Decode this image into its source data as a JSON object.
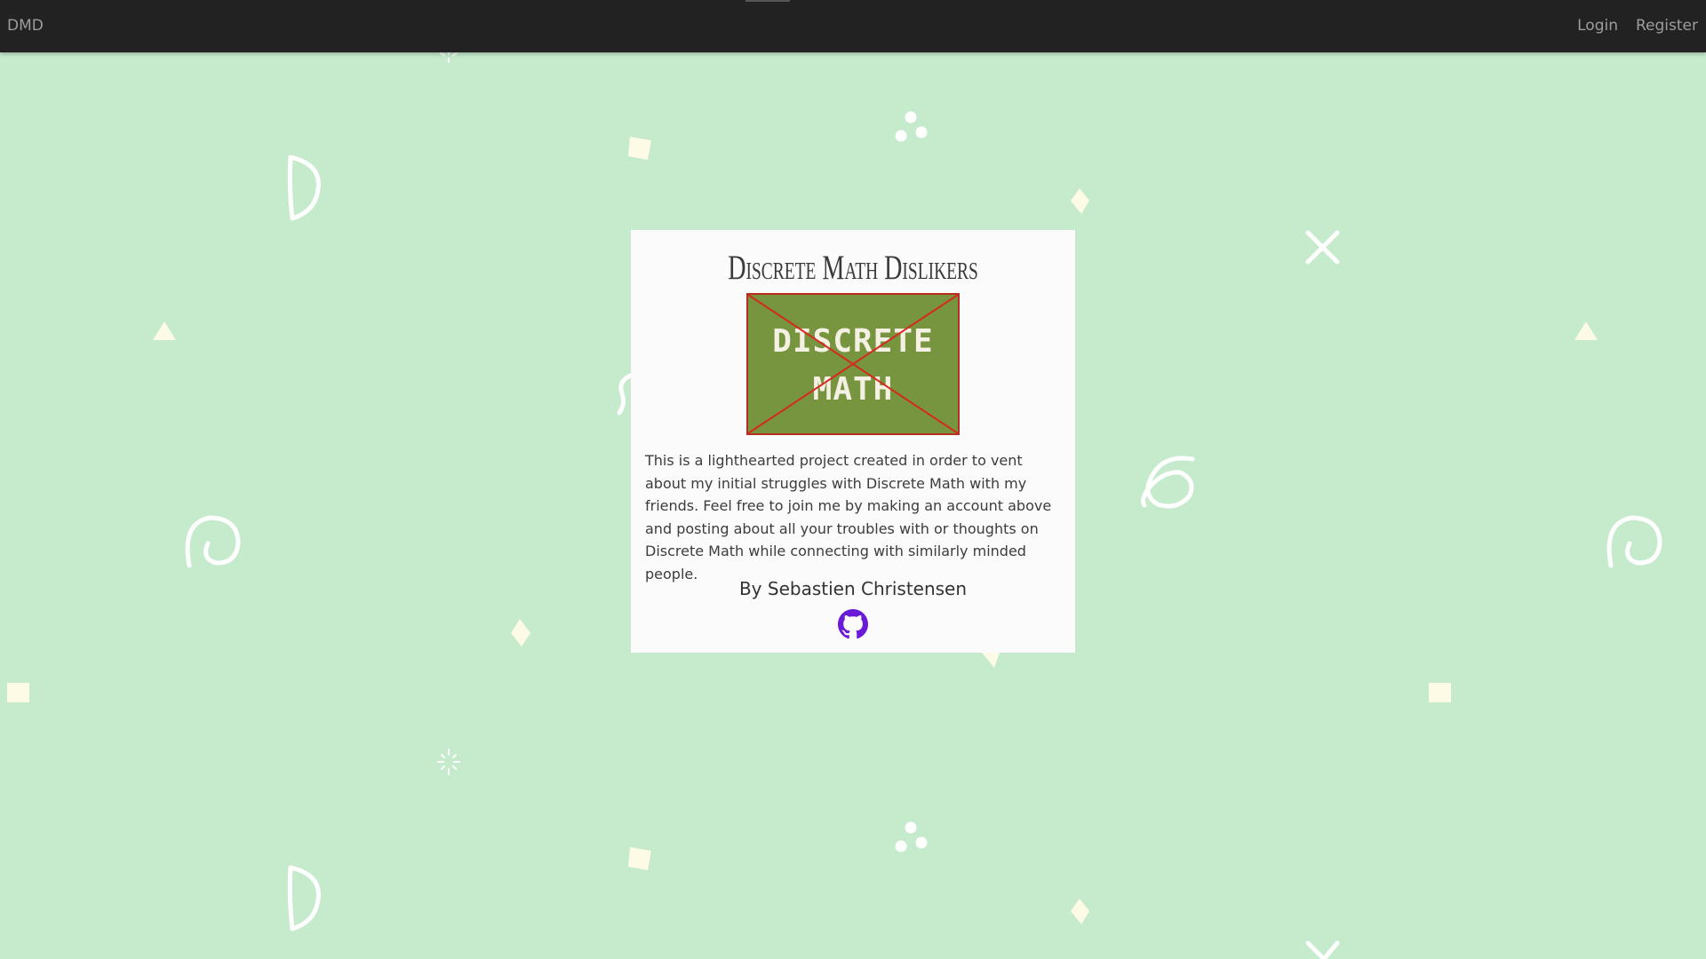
{
  "navbar": {
    "brand": "DMD",
    "links": [
      {
        "label": "Login"
      },
      {
        "label": "Register"
      }
    ]
  },
  "card": {
    "title": "Discrete Math Dislikers",
    "logo": {
      "line1": "DISCRETE",
      "line2": "MATH",
      "background_color": "#77943e",
      "cross_color": "#d42a20"
    },
    "description": "This is a lighthearted project created in order to vent about my initial struggles with Discrete Math with my friends. Feel free to join me by making an account above and posting about all your troubles with or thoughts on Discrete Math while connecting with similarly minded people.",
    "author": "By Sebastien Christensen",
    "github_icon": "github-icon"
  },
  "colors": {
    "background": "#c5ebcc",
    "navbar": "#222222",
    "nav_text": "#9d9d9d",
    "card": "#fbfbfb",
    "accent_purple": "#6a1bd8",
    "doodle_white": "#ffffff",
    "doodle_cream": "#fdfbe6"
  }
}
